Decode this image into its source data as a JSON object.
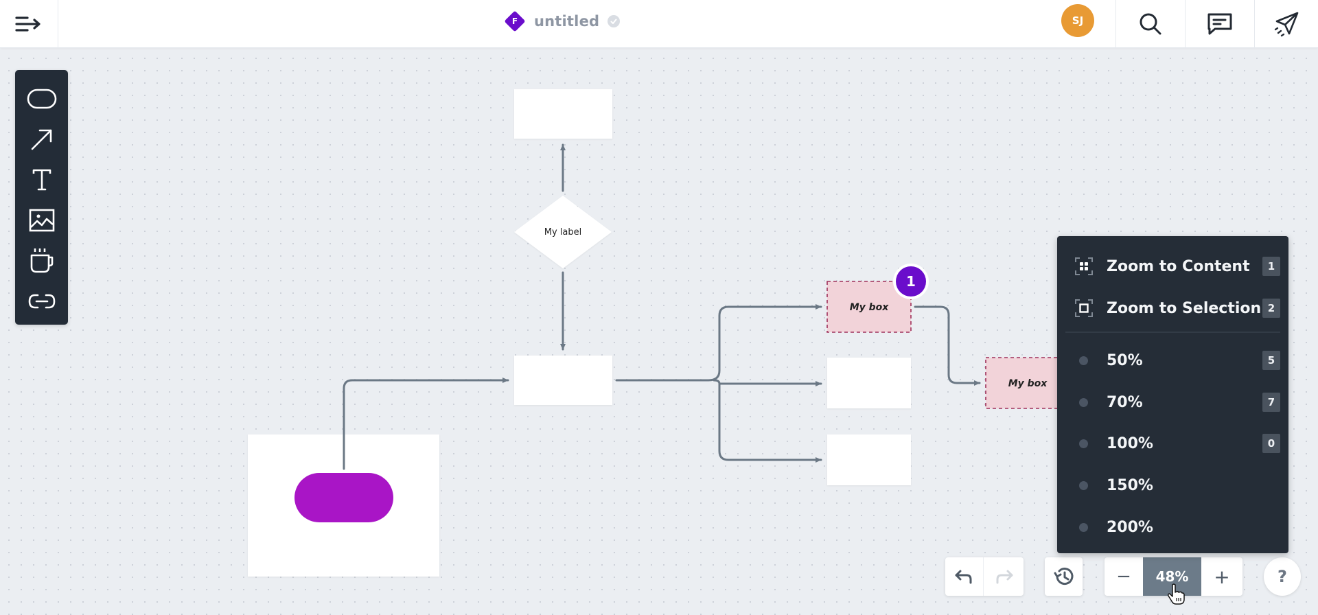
{
  "header": {
    "logo_letter": "F",
    "title": "untitled",
    "avatar_initials": "SJ",
    "icons": [
      "menu-icon",
      "saved-check-icon",
      "search-icon",
      "comment-icon",
      "share-send-icon"
    ]
  },
  "toolbar": {
    "tools": [
      {
        "name": "shape-tool",
        "icon": "rounded-rectangle-icon"
      },
      {
        "name": "connector-tool",
        "icon": "arrow-icon"
      },
      {
        "name": "text-tool",
        "icon": "text-icon"
      },
      {
        "name": "image-tool",
        "icon": "image-icon"
      },
      {
        "name": "coffee-tool",
        "icon": "coffee-cup-icon"
      },
      {
        "name": "link-tool",
        "icon": "link-icon"
      }
    ]
  },
  "diagram": {
    "decision_label": "My label",
    "selected_box_label": "My box",
    "second_box_label": "My box",
    "selection_badge": "1",
    "colors": {
      "connector": "#6b7885",
      "pill": "#a915c6",
      "selected_fill": "#f2d3d9",
      "selected_border": "#a0305a",
      "badge": "#6a0dcb"
    }
  },
  "zoom_menu": {
    "actions": [
      {
        "label": "Zoom to Content",
        "shortcut": "1",
        "icon": "zoom-to-content-icon"
      },
      {
        "label": "Zoom to Selection",
        "shortcut": "2",
        "icon": "zoom-to-selection-icon"
      }
    ],
    "presets": [
      {
        "label": "50%",
        "shortcut": "5"
      },
      {
        "label": "70%",
        "shortcut": "7"
      },
      {
        "label": "100%",
        "shortcut": "0"
      },
      {
        "label": "150%",
        "shortcut": ""
      },
      {
        "label": "200%",
        "shortcut": ""
      }
    ]
  },
  "bottom_bar": {
    "zoom_level": "48%",
    "zoom_out_label": "−",
    "zoom_in_label": "+",
    "help_label": "?",
    "redo_enabled": false
  }
}
